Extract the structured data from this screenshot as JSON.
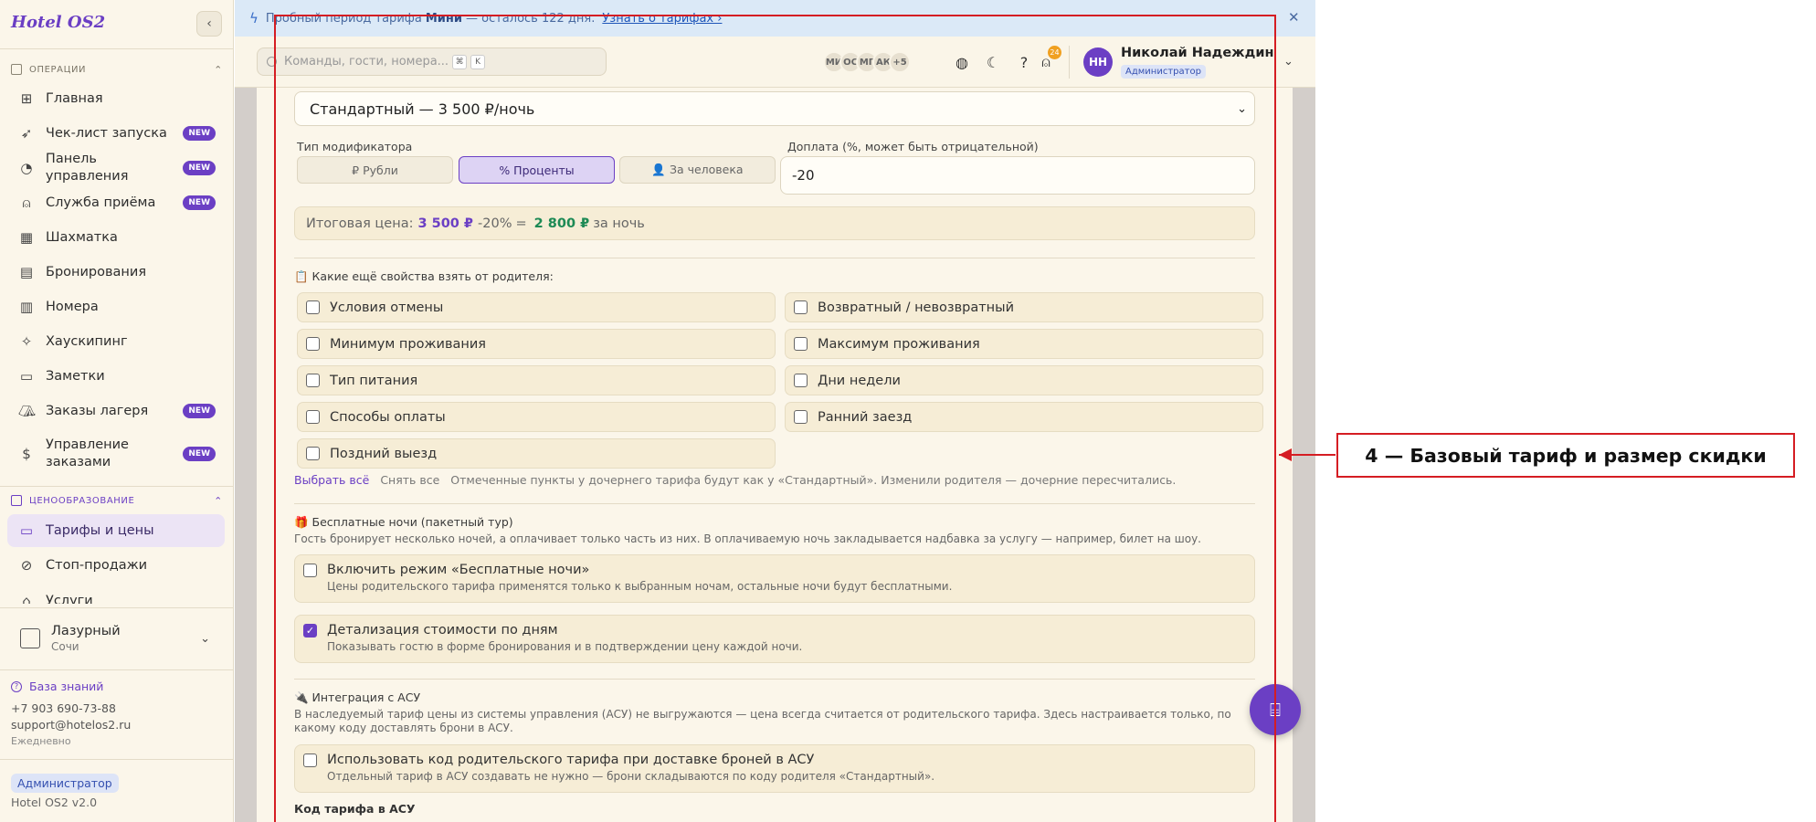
{
  "app": {
    "name": "Hotel OS2",
    "version": "Hotel OS2 v2.0"
  },
  "sidebar": {
    "sections": [
      {
        "title": "ОПЕРАЦИИ"
      },
      {
        "title": "ЦЕНООБРАЗОВАНИЕ"
      }
    ],
    "items": [
      {
        "label": "Главная",
        "icon": "grid-icon"
      },
      {
        "label": "Чек-лист запуска",
        "icon": "rocket-icon",
        "badge": "NEW"
      },
      {
        "label": "Панель управления",
        "icon": "gauge-icon",
        "badge": "NEW"
      },
      {
        "label": "Служба приёма",
        "icon": "bell-icon",
        "badge": "NEW"
      },
      {
        "label": "Шахматка",
        "icon": "table-icon"
      },
      {
        "label": "Бронирования",
        "icon": "clipboard-icon"
      },
      {
        "label": "Номера",
        "icon": "building-icon"
      },
      {
        "label": "Хаускипинг",
        "icon": "sparkle-icon"
      },
      {
        "label": "Заметки",
        "icon": "note-icon"
      },
      {
        "label": "Заказы лагеря",
        "icon": "tent-icon",
        "badge": "NEW"
      },
      {
        "label": "Управление заказами",
        "icon": "receipt-icon",
        "badge": "NEW"
      },
      {
        "label": "Тарифы и цены",
        "icon": "card-icon",
        "active": true
      },
      {
        "label": "Стоп-продажи",
        "icon": "ban-icon"
      },
      {
        "label": "Услуги",
        "icon": "tag-icon"
      }
    ],
    "hotel": {
      "name": "Лазурный",
      "city": "Сочи"
    },
    "support": {
      "kb": "База знаний",
      "phone": "+7 903 690-73-88",
      "email": "support@hotelos2.ru",
      "hours": "Ежедневно"
    },
    "role": "Администратор"
  },
  "trial": {
    "text_before": "Пробный период тарифа",
    "plan": "Мини",
    "text_after": "— осталось 122 дня.",
    "link": "Узнать о тарифах ›"
  },
  "header": {
    "search_placeholder": "Команды, гости, номера...",
    "kbd": [
      "⌘",
      "K"
    ],
    "avatars": [
      "МИ",
      "ОС",
      "МГ",
      "АК",
      "+5"
    ],
    "notif_count": "24",
    "user": {
      "initials": "НН",
      "name": "Николай Надеждин",
      "role": "Администратор"
    }
  },
  "form": {
    "parent_tariff": "Стандартный — 3 500 ₽/ночь",
    "modifier_label": "Тип модификатора",
    "modifiers": [
      "₽ Рубли",
      "% Проценты",
      "👤 За человека"
    ],
    "surcharge_label": "Доплата (%, может быть отрицательной)",
    "surcharge_value": "-20",
    "total": {
      "label": "Итоговая цена:",
      "base": "3 500 ₽",
      "mod": "-20%",
      "eq": "=",
      "result": "2 800 ₽",
      "suffix": "за ночь"
    },
    "inherit_title": "📋 Какие ещё свойства взять от родителя:",
    "inherit": [
      "Условия отмены",
      "Возвратный / невозвратный",
      "Минимум проживания",
      "Максимум проживания",
      "Тип питания",
      "Дни недели",
      "Способы оплаты",
      "Ранний заезд",
      "Поздний выезд"
    ],
    "select_all": "Выбрать всё",
    "clear_all": "Снять все",
    "inherit_note": "Отмеченные пункты у дочернего тарифа будут как у «Стандартный». Изменили родителя — дочерние пересчитались.",
    "free_title": "🎁 Бесплатные ночи (пакетный тур)",
    "free_desc": "Гость бронирует несколько ночей, а оплачивает только часть из них. В оплачиваемую ночь закладывается надбавка за услугу — например, билет на шоу.",
    "free_toggle": "Включить режим «Бесплатные ночи»",
    "free_toggle_sub": "Цены родительского тарифа применятся только к выбранным ночам, остальные ночи будут бесплатными.",
    "detail_toggle": "Детализация стоимости по дням",
    "detail_toggle_sub": "Показывать гостю в форме бронирования и в подтверждении цену каждой ночи.",
    "asu_title": "🔌 Интеграция с АСУ",
    "asu_desc": "В наследуемый тариф цены из системы управления (АСУ) не выгружаются — цена всегда считается от родительского тарифа. Здесь настраивается только, по какому коду доставлять брони в АСУ.",
    "asu_toggle": "Использовать код родительского тарифа при доставке броней в АСУ",
    "asu_toggle_sub": "Отдельный тариф в АСУ создавать не нужно — брони складываются по коду родителя «Стандартный».",
    "asu_code_label": "Код тарифа в АСУ"
  },
  "annotation": {
    "label": "4 — Базовый тариф и размер скидки",
    "color": "#d51d23"
  },
  "colors": {
    "accent": "#6b3fc4",
    "success": "#1d8a55",
    "background": "#fbf6ea"
  }
}
